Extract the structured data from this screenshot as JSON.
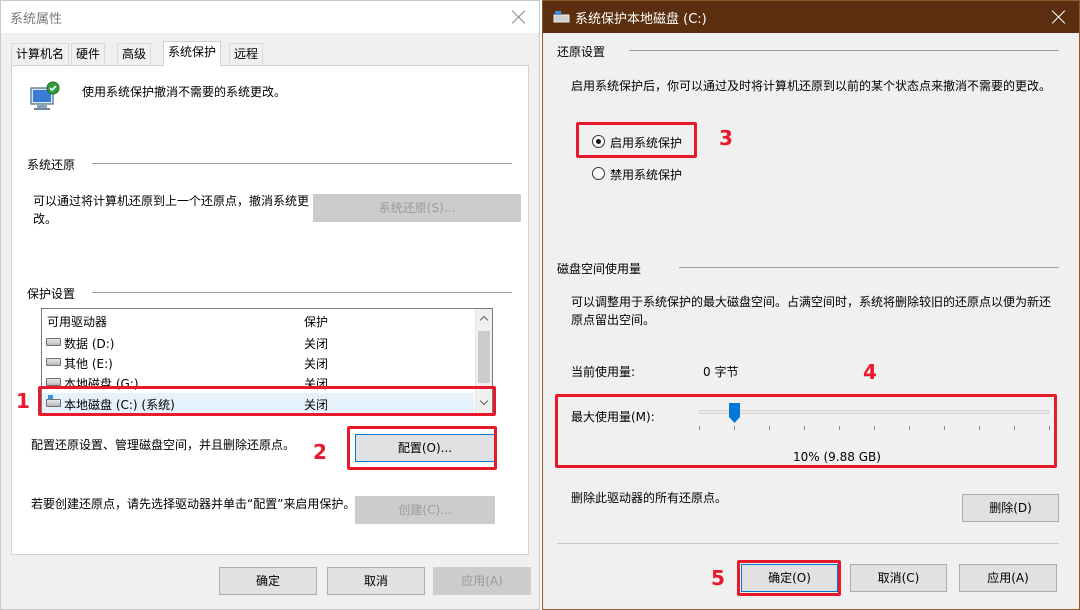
{
  "left_window": {
    "title": "系统属性",
    "tabs": [
      {
        "label": "计算机名",
        "active": false
      },
      {
        "label": "硬件",
        "active": false
      },
      {
        "label": "高级",
        "active": false
      },
      {
        "label": "系统保护",
        "active": true
      },
      {
        "label": "远程",
        "active": false
      }
    ],
    "description": "使用系统保护撤消不需要的系统更改。",
    "restore_group": {
      "label": "系统还原",
      "text": "可以通过将计算机还原到上一个还原点，撤消系统更改。",
      "button": "系统还原(S)..."
    },
    "protect_group": {
      "label": "保护设置",
      "columns": [
        "可用驱动器",
        "保护"
      ],
      "drives": [
        {
          "name": "数据 (D:)",
          "status": "关闭",
          "selected": false
        },
        {
          "name": "其他 (E:)",
          "status": "关闭",
          "selected": false
        },
        {
          "name": "本地磁盘 (G:)",
          "status": "关闭",
          "selected": false
        },
        {
          "name": "本地磁盘 (C:) (系统)",
          "status": "关闭",
          "selected": true
        }
      ],
      "config_text": "配置还原设置、管理磁盘空间，并且删除还原点。",
      "config_button": "配置(O)...",
      "create_text": "若要创建还原点，请先选择驱动器并单击“配置”来启用保护。",
      "create_button": "创建(C)..."
    },
    "footer": {
      "ok": "确定",
      "cancel": "取消",
      "apply": "应用(A)"
    }
  },
  "right_window": {
    "title": "系统保护本地磁盘 (C:)",
    "restore_settings": {
      "label": "还原设置",
      "text": "启用系统保护后，你可以通过及时将计算机还原到以前的某个状态点来撤消不需要的更改。",
      "options": [
        {
          "label": "启用系统保护",
          "checked": true
        },
        {
          "label": "禁用系统保护",
          "checked": false
        }
      ]
    },
    "disk_usage": {
      "label": "磁盘空间使用量",
      "text": "可以调整用于系统保护的最大磁盘空间。占满空间时，系统将删除较旧的还原点以便为新还原点留出空间。",
      "current_label": "当前使用量:",
      "current_value": "0 字节",
      "max_label": "最大使用量(M):",
      "max_value": "10% (9.88 GB)",
      "slider_fraction": 0.1,
      "delete_text": "删除此驱动器的所有还原点。",
      "delete_button": "删除(D)"
    },
    "footer": {
      "ok": "确定(O)",
      "cancel": "取消(C)",
      "apply": "应用(A)"
    }
  },
  "annotations": [
    "1",
    "2",
    "3",
    "4",
    "5"
  ],
  "colors": {
    "annotation": "#e8192c",
    "titlebar_right": "#5a2e0e",
    "slider": "#0078d7"
  }
}
